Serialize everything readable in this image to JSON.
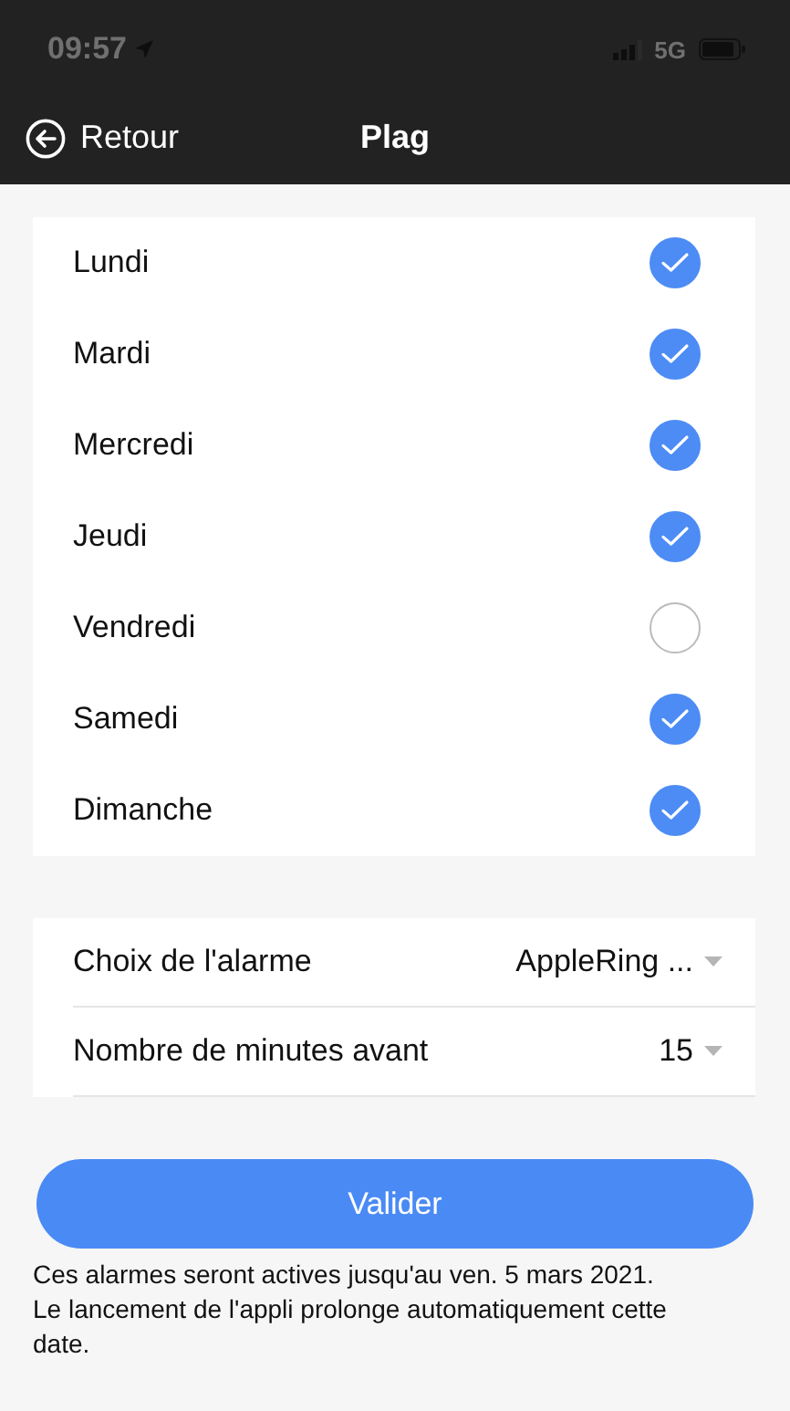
{
  "status_bar": {
    "time": "09:57",
    "network": "5G"
  },
  "nav": {
    "back": "Retour",
    "title": "Plag"
  },
  "days": [
    {
      "label": "Lundi",
      "checked": true
    },
    {
      "label": "Mardi",
      "checked": true
    },
    {
      "label": "Mercredi",
      "checked": true
    },
    {
      "label": "Jeudi",
      "checked": true
    },
    {
      "label": "Vendredi",
      "checked": false
    },
    {
      "label": "Samedi",
      "checked": true
    },
    {
      "label": "Dimanche",
      "checked": true
    }
  ],
  "settings": [
    {
      "label": "Choix de l'alarme",
      "value": "AppleRing ..."
    },
    {
      "label": "Nombre de minutes avant",
      "value": "15"
    }
  ],
  "submit": "Valider",
  "note": "Ces alarmes seront actives jusqu'au ven. 5 mars 2021.\nLe lancement de l'appli prolonge automatiquement cette date."
}
